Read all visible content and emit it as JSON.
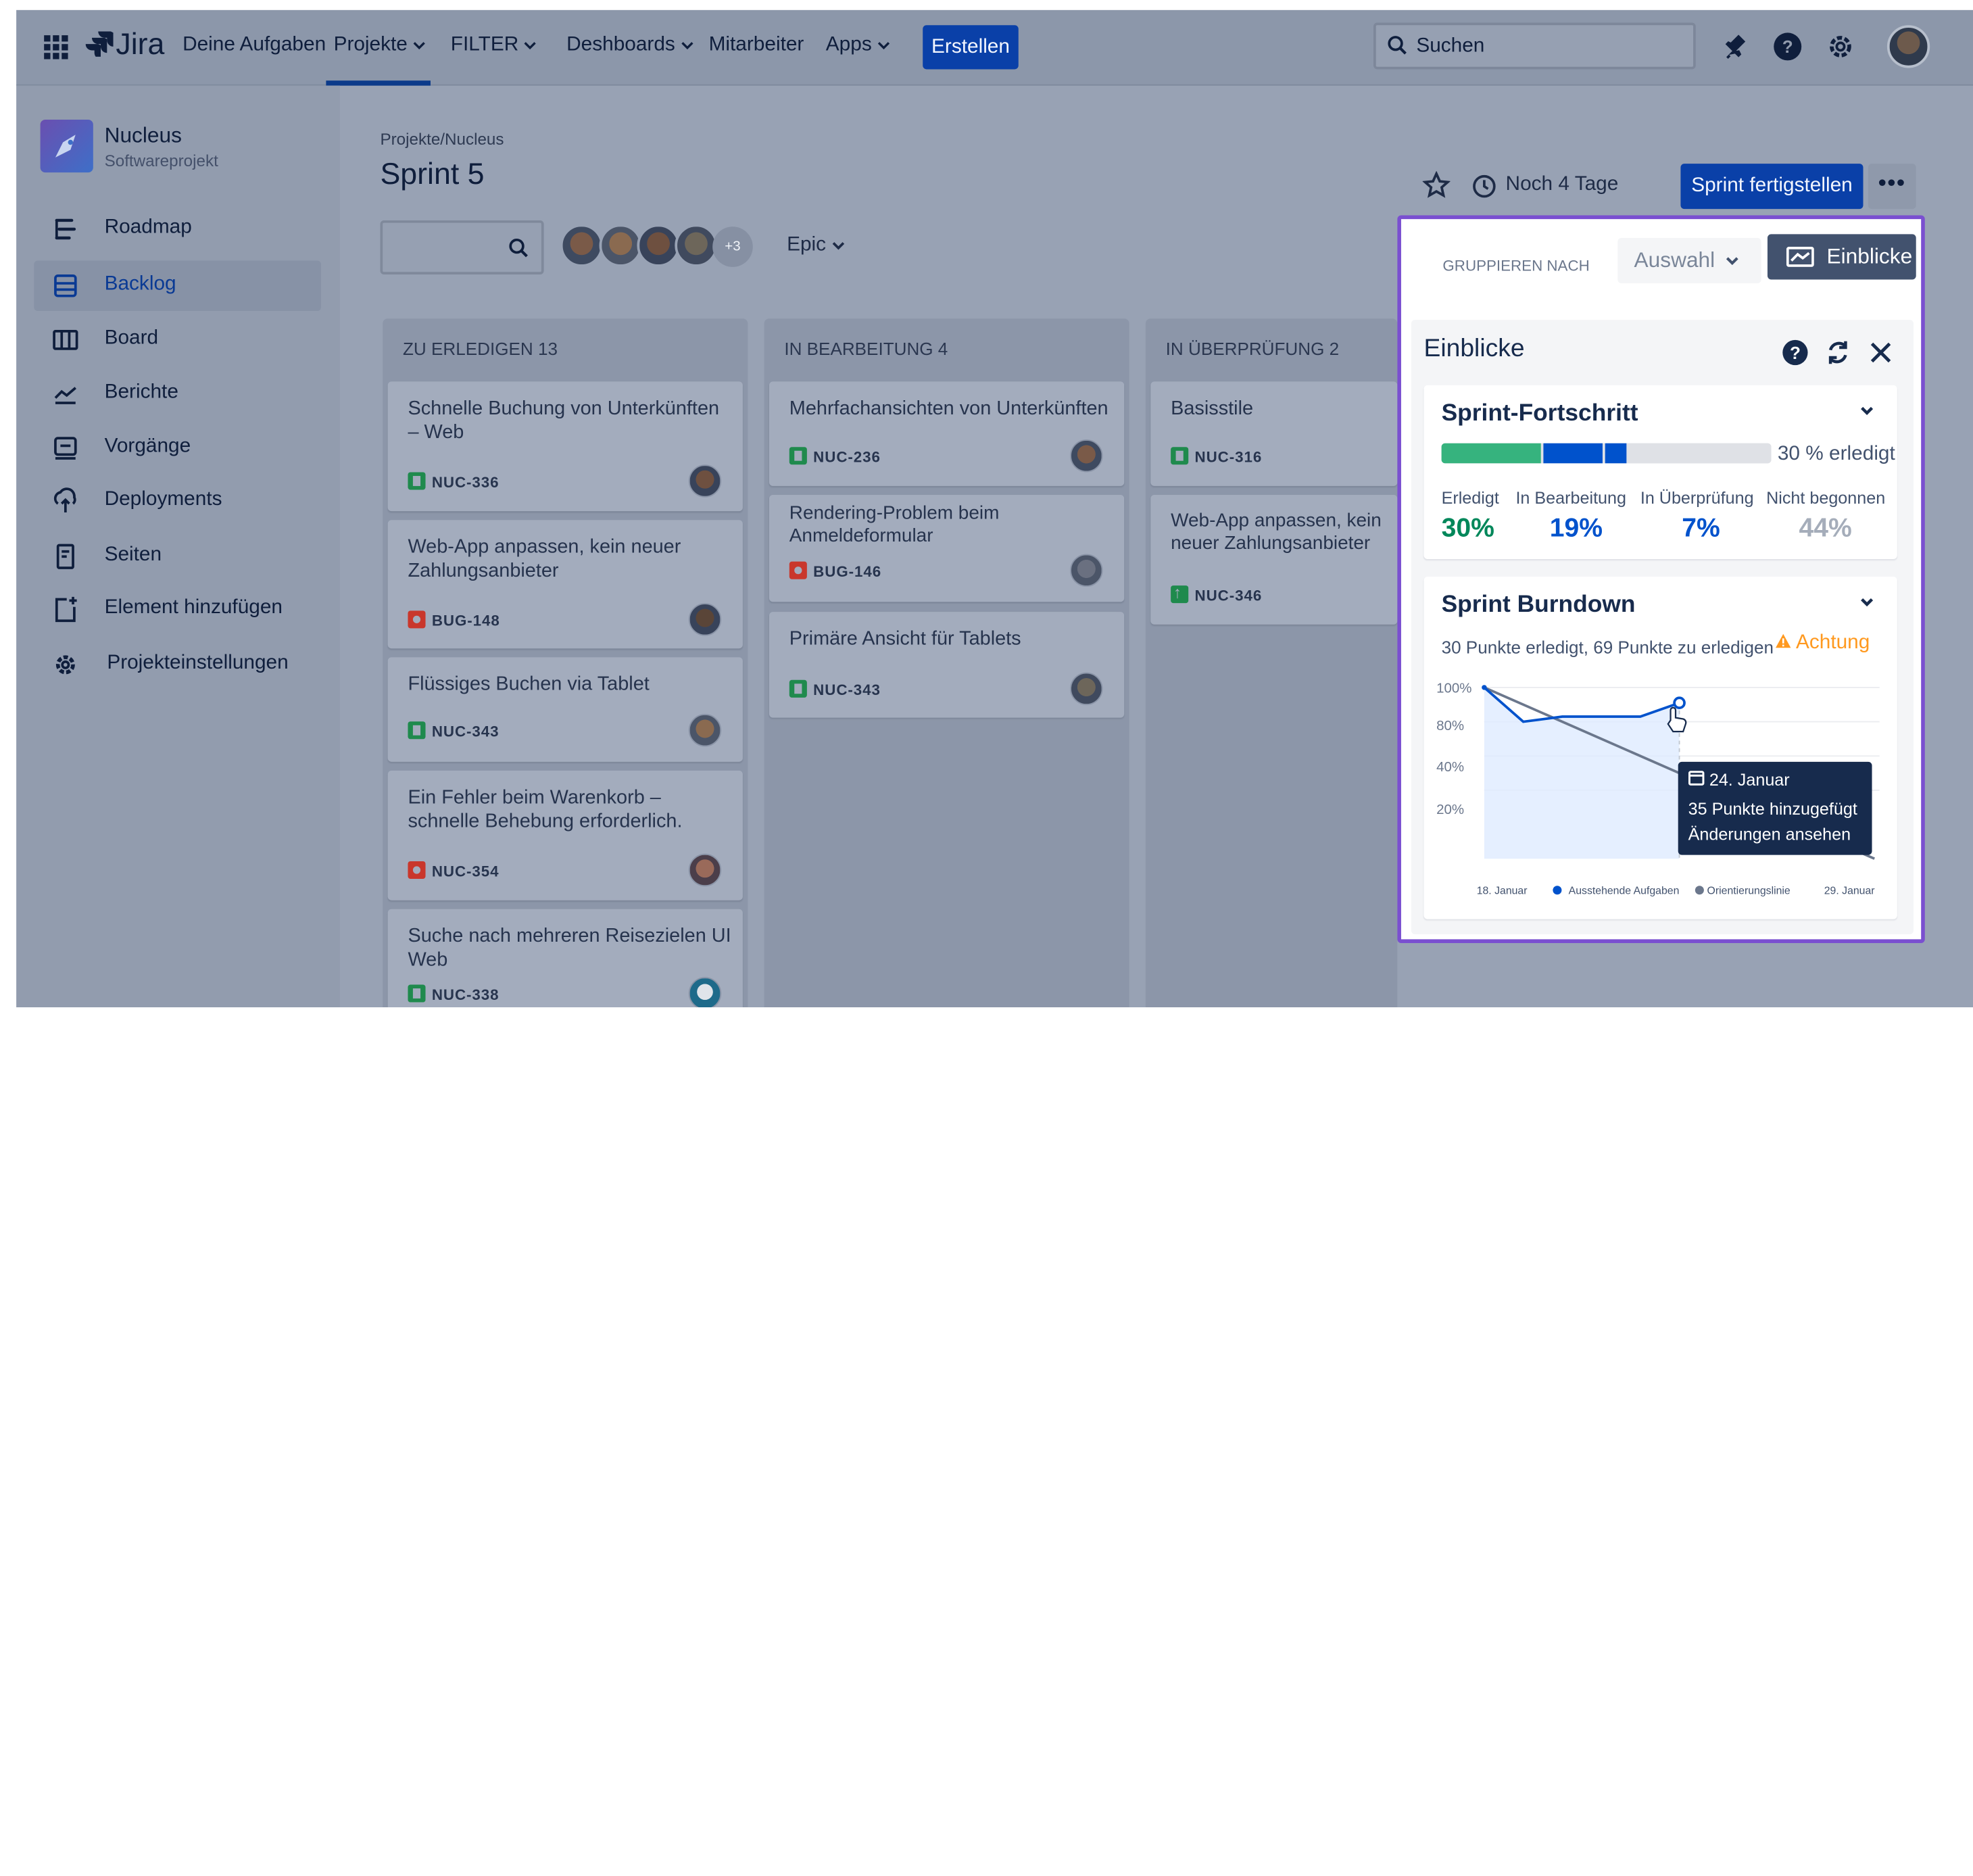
{
  "topbar": {
    "app_name": "Jira",
    "nav": [
      "Deine Aufgaben",
      "Projekte",
      "FILTER",
      "Deshboards",
      "Mitarbeiter",
      "Apps"
    ],
    "create": "Erstellen",
    "search_placeholder": "Suchen"
  },
  "sidebar": {
    "project_name": "Nucleus",
    "project_type": "Softwareprojekt",
    "items": [
      "Roadmap",
      "Backlog",
      "Board",
      "Berichte",
      "Vorgänge",
      "Deployments",
      "Seiten",
      "Element hinzufügen",
      "Projekteinstellungen"
    ],
    "active": "Backlog"
  },
  "main": {
    "breadcrumb": "Projekte/Nucleus",
    "title": "Sprint 5",
    "avatars_more": "+3",
    "epic_filter": "Epic",
    "days_left": "Noch 4 Tage",
    "finish_sprint": "Sprint fertigstellen",
    "more": "•••"
  },
  "columns": [
    {
      "title": "ZU ERLEDIGEN 13",
      "cards": [
        {
          "title": "Schnelle Buchung von Unterkünften – Web",
          "key": "NUC-336",
          "type": "story"
        },
        {
          "title": "Web-App anpassen, kein neuer Zahlungsanbieter",
          "key": "BUG-148",
          "type": "bug"
        },
        {
          "title": "Flüssiges Buchen via Tablet",
          "key": "NUC-343",
          "type": "story"
        },
        {
          "title": "Ein Fehler beim Warenkorb – schnelle Behebung erforderlich.",
          "key": "NUC-354",
          "type": "bug"
        },
        {
          "title": "Suche nach mehreren Reisezielen UI Web",
          "key": "NUC-338",
          "type": "story"
        }
      ]
    },
    {
      "title": "IN BEARBEITUNG 4",
      "cards": [
        {
          "title": "Mehrfachansichten von Unterkünften",
          "key": "NUC-236",
          "type": "story"
        },
        {
          "title": "Rendering-Problem beim Anmeldeformular",
          "key": "BUG-146",
          "type": "bug"
        },
        {
          "title": "Primäre Ansicht für Tablets",
          "key": "NUC-343",
          "type": "story"
        }
      ]
    },
    {
      "title": "IN ÜBERPRÜFUNG 2",
      "cards": [
        {
          "title": "Basisstile",
          "key": "NUC-316",
          "type": "story"
        },
        {
          "title": "Web-App anpassen, kein neuer Zahlungsanbieter",
          "key": "NUC-346",
          "type": "improvement"
        }
      ]
    }
  ],
  "insights": {
    "group_by_label": "GRUPPIEREN NACH",
    "group_by_value": "Auswahl",
    "button": "Einblicke",
    "panel_title": "Einblicke",
    "progress": {
      "title": "Sprint-Fortschritt",
      "done_label": "30 % erledigt",
      "segments": [
        {
          "label": "Erledigt",
          "value": "30%",
          "fraction": 0.3,
          "color": "#36b37e"
        },
        {
          "label": "In Bearbeitung",
          "value": "19%",
          "fraction": 0.19,
          "color": "#0052cc"
        },
        {
          "label": "In Überprüfung",
          "value": "7%",
          "fraction": 0.07,
          "color": "#0065ff"
        },
        {
          "label": "Nicht begonnen",
          "value": "44%",
          "fraction": 0.44,
          "color": "#dfe1e6"
        }
      ],
      "value_colors": [
        "#00875a",
        "#0052cc",
        "#0052cc",
        "#a5adba"
      ]
    },
    "burndown": {
      "title": "Sprint Burndown",
      "subtitle": "30 Punkte erledigt, 69 Punkte zu erledigen",
      "warning": "Achtung",
      "tooltip": {
        "date": "24. Januar",
        "line1": "35 Punkte hinzugefügt",
        "line2": "Änderungen ansehen"
      }
    }
  },
  "chart_data": {
    "type": "line",
    "title": "Sprint Burndown",
    "x_labels": [
      "18. Januar",
      "29. Januar"
    ],
    "y_ticks": [
      "100%",
      "80%",
      "40%",
      "20%"
    ],
    "series": [
      {
        "name": "Ausstehende Aufgaben",
        "color": "#0052cc",
        "x": [
          0,
          1,
          2,
          3,
          4,
          5
        ],
        "y": [
          100,
          80,
          83,
          83,
          83,
          91
        ]
      },
      {
        "name": "Orientierungslinie",
        "color": "#6b778c",
        "x": [
          0,
          10
        ],
        "y": [
          100,
          0
        ]
      }
    ],
    "highlight_point": {
      "x": 5,
      "y": 91
    }
  }
}
